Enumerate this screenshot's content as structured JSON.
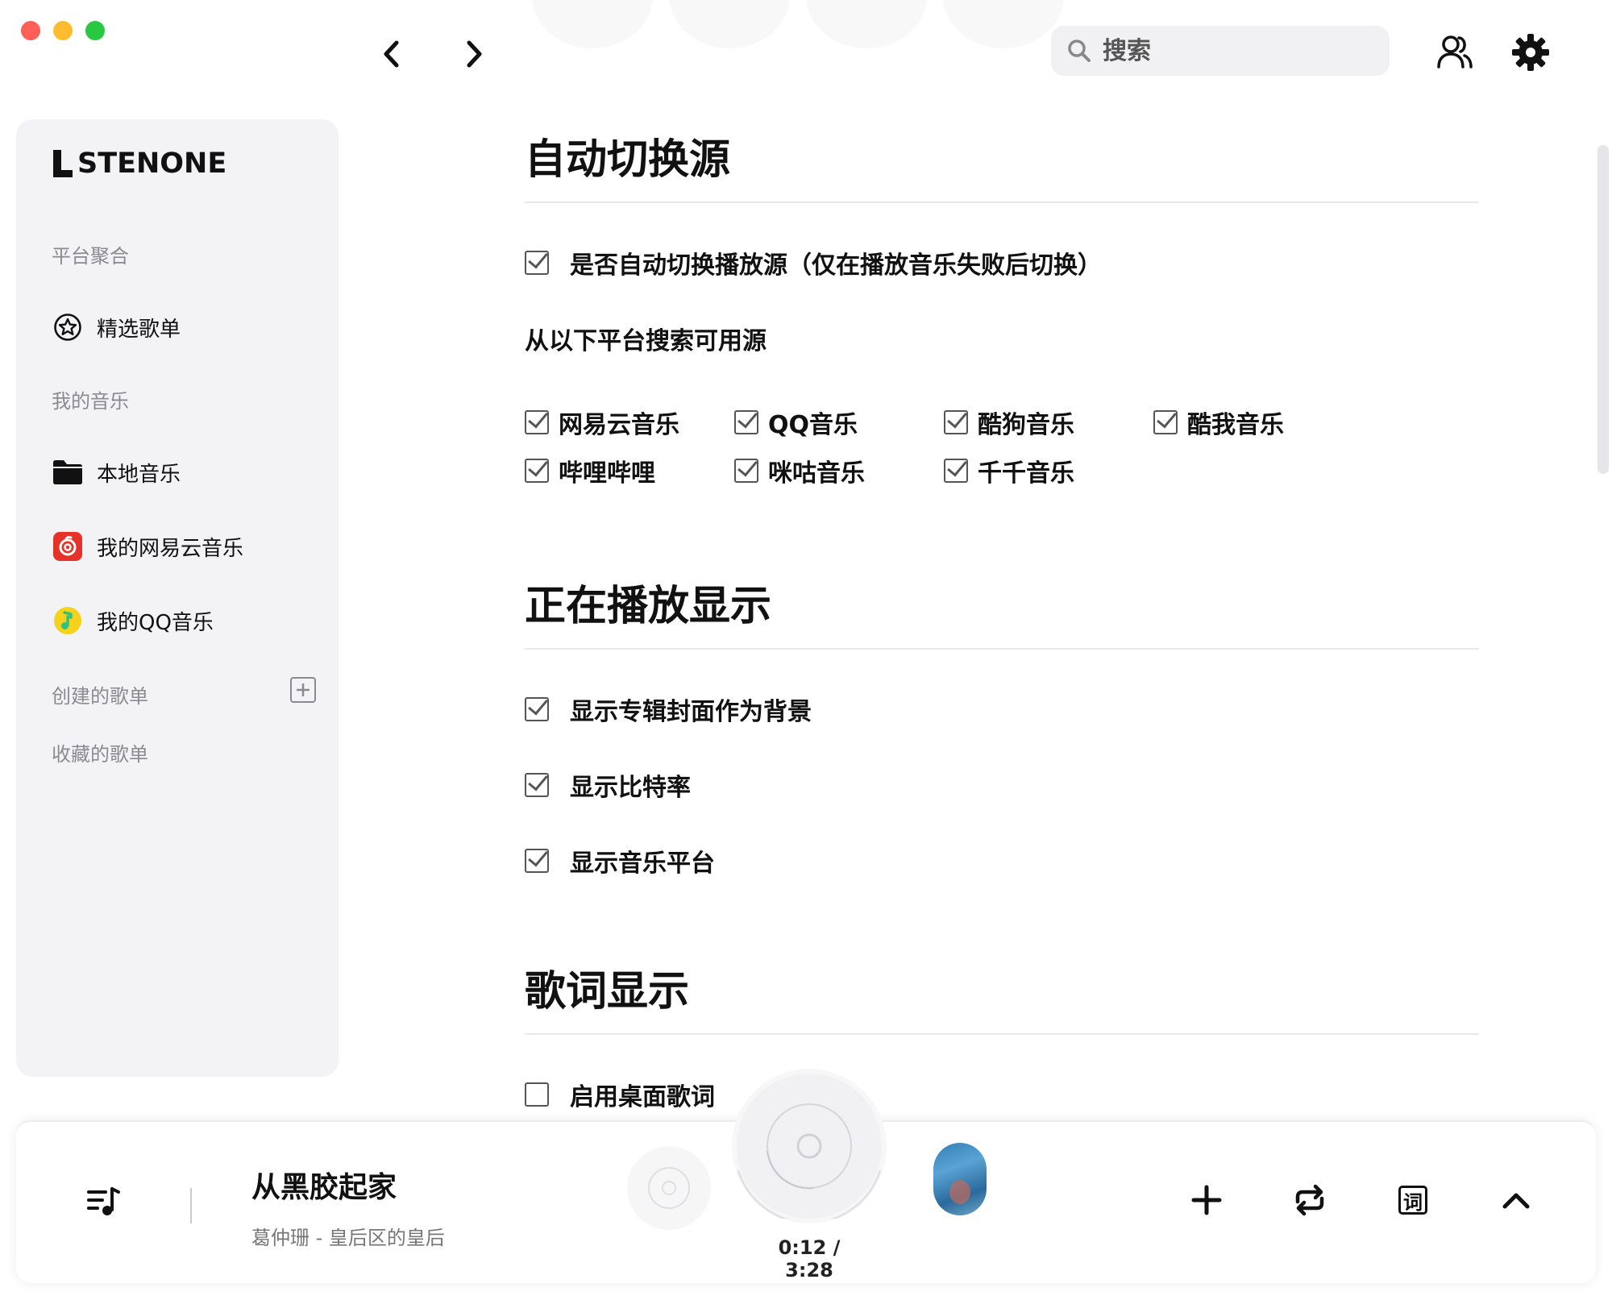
{
  "colors": {
    "sidebar_bg": "#f3f3f6",
    "accent_text": "#111111",
    "muted_text": "#8a8a8f",
    "traffic_red": "#ff5f57",
    "traffic_yellow": "#febc2e",
    "traffic_green": "#28c840",
    "netease_red": "#e6332a",
    "qq_yellow": "#f7d21b",
    "qq_green": "#31c27c"
  },
  "header": {
    "search_placeholder": "搜索",
    "icons": [
      "back-arrow-icon",
      "forward-arrow-icon",
      "search-icon",
      "users-icon",
      "gear-icon"
    ]
  },
  "sidebar": {
    "logo": "STENONE",
    "section_platform": "平台聚合",
    "featured": "精选歌单",
    "section_my_music": "我的音乐",
    "local_music": "本地音乐",
    "netease": "我的网易云音乐",
    "qq": "我的QQ音乐",
    "created_playlists": "创建的歌单",
    "collected_playlists": "收藏的歌单"
  },
  "settings": {
    "auto_switch": {
      "title": "自动切换源",
      "option": "是否自动切换播放源（仅在播放音乐失败后切换）",
      "option_checked": true,
      "subtitle": "从以下平台搜索可用源",
      "platforms": [
        {
          "label": "网易云音乐",
          "checked": true
        },
        {
          "label": "QQ音乐",
          "checked": true
        },
        {
          "label": "酷狗音乐",
          "checked": true
        },
        {
          "label": "酷我音乐",
          "checked": true
        },
        {
          "label": "哔哩哔哩",
          "checked": true
        },
        {
          "label": "咪咕音乐",
          "checked": true
        },
        {
          "label": "千千音乐",
          "checked": true
        }
      ]
    },
    "now_playing": {
      "title": "正在播放显示",
      "options": [
        {
          "label": "显示专辑封面作为背景",
          "checked": true
        },
        {
          "label": "显示比特率",
          "checked": true
        },
        {
          "label": "显示音乐平台",
          "checked": true
        }
      ]
    },
    "lyrics": {
      "title": "歌词显示",
      "options": [
        {
          "label": "启用桌面歌词",
          "checked": false
        }
      ]
    }
  },
  "player": {
    "song_title": "从黑胶起家",
    "artist_album": "葛仲珊 - 皇后区的皇后",
    "time": "0:12 / 3:28",
    "lyric_button": "词",
    "icons": [
      "queue-icon",
      "add-icon",
      "repeat-icon",
      "lyric-icon",
      "chevron-up-icon"
    ]
  }
}
